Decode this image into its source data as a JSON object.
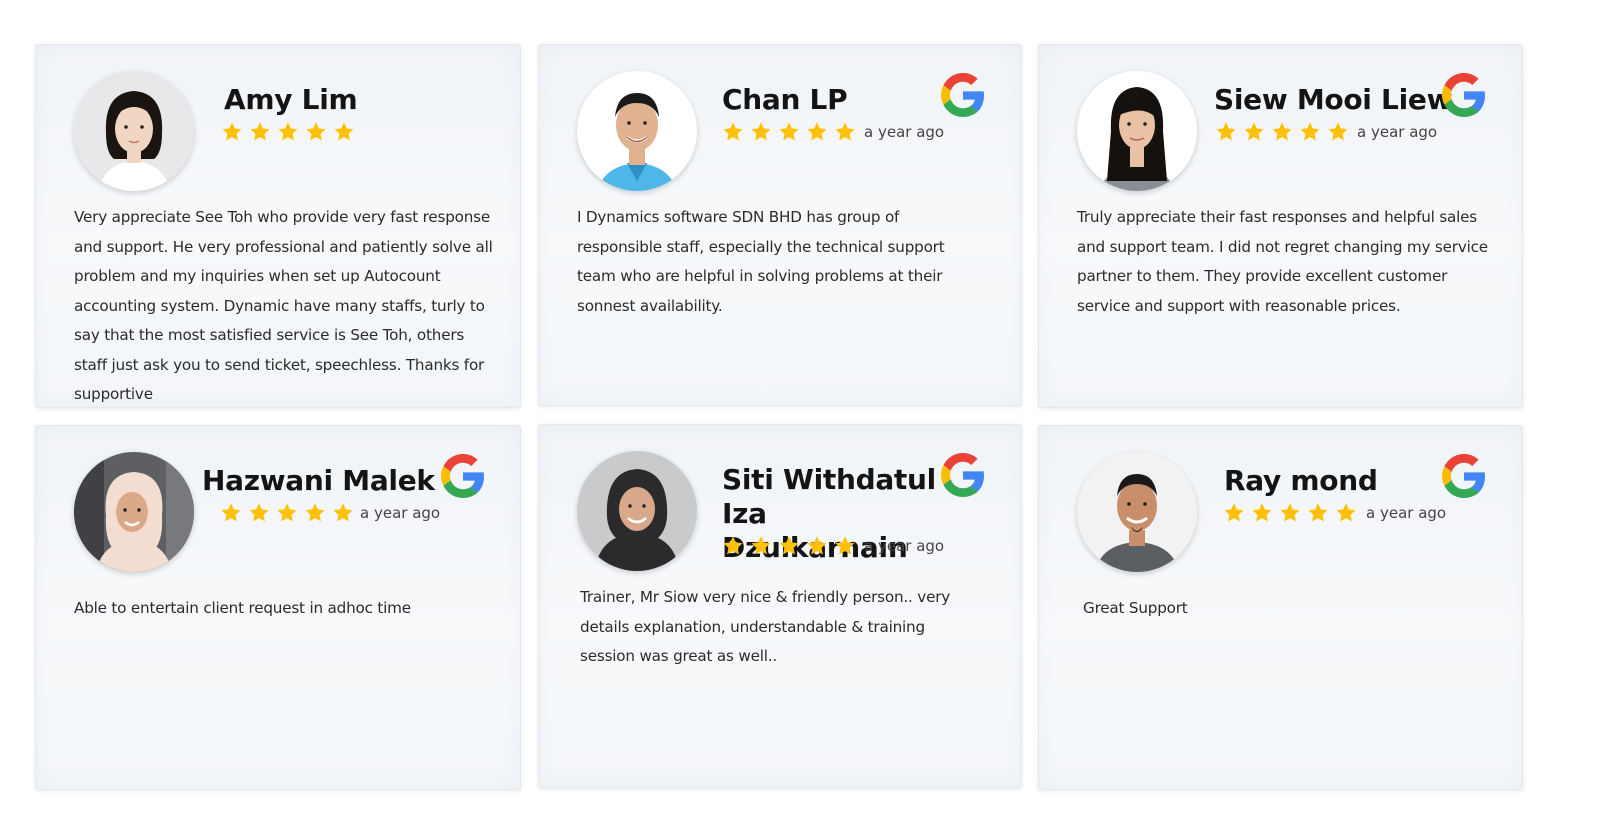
{
  "reviews": [
    {
      "name": "Amy Lim",
      "rating": 5,
      "time": "",
      "google_logo": false,
      "avatar": {
        "skin": "#f2d6c4",
        "hair": "#1b1512",
        "shirt": "#ffffff",
        "bg": "#e8e8ea"
      },
      "text": "Very appreciate See Toh who provide very fast response and support. He very professional and patiently solve all problem and my inquiries when set up Autocount accounting system. Dynamic have many staffs, turly to say that the most satisfied service is See Toh, others staff just ask you to send ticket, speechless. Thanks for supportive"
    },
    {
      "name": "Chan LP",
      "rating": 5,
      "time": "a year ago",
      "google_logo": true,
      "avatar": {
        "skin": "#e0b28f",
        "hair": "#1a1a1a",
        "shirt": "#4fb7e8",
        "bg": "#ffffff"
      },
      "text": "I Dynamics software SDN BHD has group of responsible staff, especially the technical support team who are helpful in solving problems at their sonnest availability."
    },
    {
      "name": "Siew Mooi Liew",
      "rating": 5,
      "time": "a year ago",
      "google_logo": true,
      "avatar": {
        "skin": "#e9c2a6",
        "hair": "#15110f",
        "shirt": "#8a8f95",
        "bg": "#ffffff"
      },
      "text": "Truly appreciate their fast responses and helpful sales and support team. I did not regret changing my service partner to them. They provide excellent customer service and support with reasonable prices."
    },
    {
      "name": "Hazwani Malek",
      "rating": 5,
      "time": "a year ago",
      "google_logo": true,
      "avatar": {
        "skin": "#d9a98a",
        "hair": "#f3ddd0",
        "shirt": "#f3ddd0",
        "bg": "#5d5f63"
      },
      "text": "Able to entertain client request in adhoc time"
    },
    {
      "name": "Siti Withdatul Iza Dzulkarnain",
      "rating": 5,
      "time": "a year ago",
      "google_logo": true,
      "avatar": {
        "skin": "#d8a88a",
        "hair": "#2b2b2e",
        "shirt": "#2b2b2e",
        "bg": "#c9cacc"
      },
      "text": "Trainer, Mr Siow very nice & friendly person.. very details explanation, understandable & training session was great as well.."
    },
    {
      "name": "Ray mond",
      "rating": 5,
      "time": "a year ago",
      "google_logo": true,
      "avatar": {
        "skin": "#c98f6d",
        "hair": "#1c1a18",
        "shirt": "#5b5f63",
        "bg": "#f2f2f2"
      },
      "text": "Great Support"
    }
  ],
  "colors": {
    "star": "#FFC107",
    "google_blue": "#4285F4",
    "google_red": "#EA4335",
    "google_yellow": "#FBBC05",
    "google_green": "#34A853"
  }
}
